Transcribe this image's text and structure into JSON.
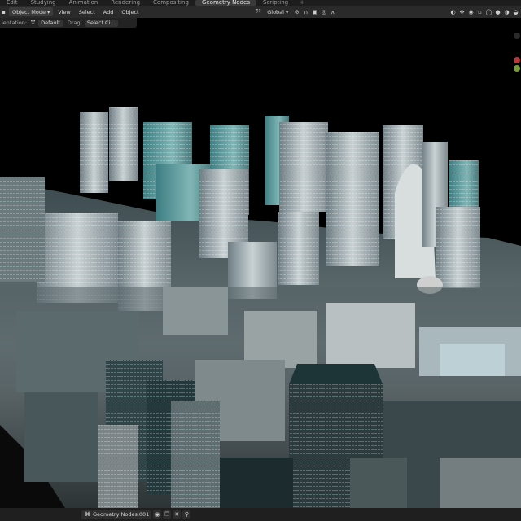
{
  "workspace_tabs": [
    {
      "label": "Edit",
      "active": false
    },
    {
      "label": "Studying",
      "active": false
    },
    {
      "label": "Animation",
      "active": false
    },
    {
      "label": "Rendering",
      "active": false
    },
    {
      "label": "Compositing",
      "active": false
    },
    {
      "label": "Geometry Nodes",
      "active": true
    },
    {
      "label": "Scripting",
      "active": false
    }
  ],
  "workspace_add": "+",
  "header": {
    "mode": "Object Mode",
    "menus": [
      "View",
      "Select",
      "Add",
      "Object"
    ],
    "transform_orientation": "Global"
  },
  "tool_settings": {
    "orientation_label": "ientation:",
    "orientation_value": "Default",
    "drag_label": "Drag:",
    "drag_value": "Select Ci..."
  },
  "footer": {
    "node_tree_name": "Geometry Nodes.001"
  },
  "icons": {
    "cursor": "cursor-icon",
    "snap": "magnet-icon",
    "proportional": "proportional-icon",
    "overlays": "overlays-icon",
    "shading": "shading-icon",
    "close": "close-icon",
    "pin": "pin-icon"
  }
}
